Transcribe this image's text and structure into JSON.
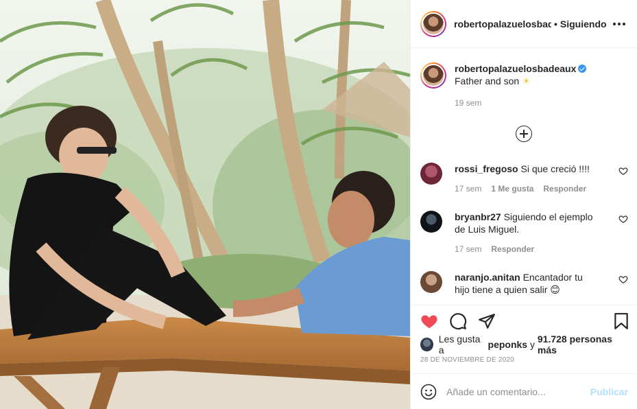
{
  "header": {
    "username": "robertopalazuelosbadeaux",
    "separator": "•",
    "follow_state": "Siguiendo"
  },
  "caption": {
    "username": "robertopalazuelosbadeaux",
    "text": "Father and son",
    "emoji": "☀",
    "time": "19 sem"
  },
  "comments": [
    {
      "username": "rossi_fregoso",
      "text": "Si que creció !!!!",
      "time": "17 sem",
      "likes": "1 Me gusta",
      "reply": "Responder"
    },
    {
      "username": "bryanbr27",
      "text": "Siguiendo el ejemplo de Luis Miguel.",
      "time": "17 sem",
      "likes": "",
      "reply": "Responder"
    },
    {
      "username": "naranjo.anitan",
      "text": "Encantador tu hijo tiene a quien salir 😊",
      "time": "",
      "likes": "",
      "reply": ""
    }
  ],
  "likes": {
    "prefix": "Les gusta a",
    "user": "peponks",
    "conjunction": "y",
    "others": "91.728 personas más"
  },
  "date": "28 de noviembre de 2020",
  "add_comment": {
    "placeholder": "Añade un comentario...",
    "post_label": "Publicar"
  },
  "icons": {
    "like": "heart-icon",
    "comment": "comment-icon",
    "share": "share-icon",
    "save": "bookmark-icon",
    "more": "more-icon",
    "emoji": "emoji-icon",
    "load_more": "plus-circle-icon"
  },
  "colors": {
    "liked": "#ed4956",
    "verified": "#3897f0",
    "post_disabled": "#b2dffc",
    "secondary_text": "#8e8e8e"
  }
}
